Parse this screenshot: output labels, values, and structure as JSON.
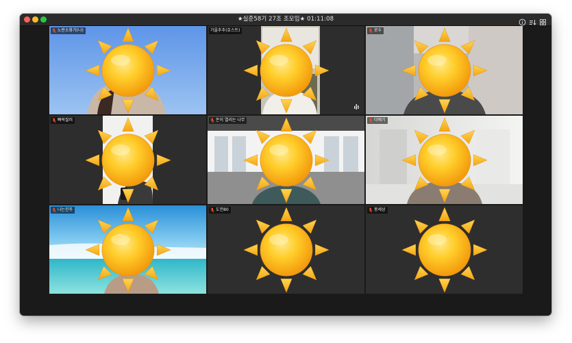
{
  "window": {
    "title": "★실준58기 27조 조모임★ 01:11:08"
  },
  "toolbar": {
    "icons": [
      "info-icon",
      "sort-icon",
      "gallery-view-icon"
    ]
  },
  "participants": [
    {
      "name": "노란소화기(나)",
      "muted": true,
      "active": false,
      "background": "sky",
      "person": true
    },
    {
      "name": "가을추추(호스트)",
      "muted": false,
      "active": true,
      "background": "dark-window",
      "person": true
    },
    {
      "name": "로수",
      "muted": true,
      "active": false,
      "background": "blurred-room",
      "person": true
    },
    {
      "name": "빠락질러",
      "muted": true,
      "active": false,
      "background": "dark-white",
      "person": true
    },
    {
      "name": "돈이 열리는 나무",
      "muted": true,
      "active": false,
      "background": "office",
      "person": true
    },
    {
      "name": "더애기",
      "muted": true,
      "active": false,
      "background": "hallway",
      "person": true
    },
    {
      "name": "나는진주",
      "muted": true,
      "active": false,
      "background": "beach",
      "person": true
    },
    {
      "name": "도전80",
      "muted": true,
      "active": false,
      "background": "none",
      "person": false
    },
    {
      "name": "봉세상",
      "muted": true,
      "active": false,
      "background": "none",
      "person": false
    }
  ],
  "colors": {
    "active_border": "#27d6a5",
    "mic_muted": "#e8532d",
    "sun_body": "#ffc21a",
    "sun_ray": "#f7b21c"
  }
}
